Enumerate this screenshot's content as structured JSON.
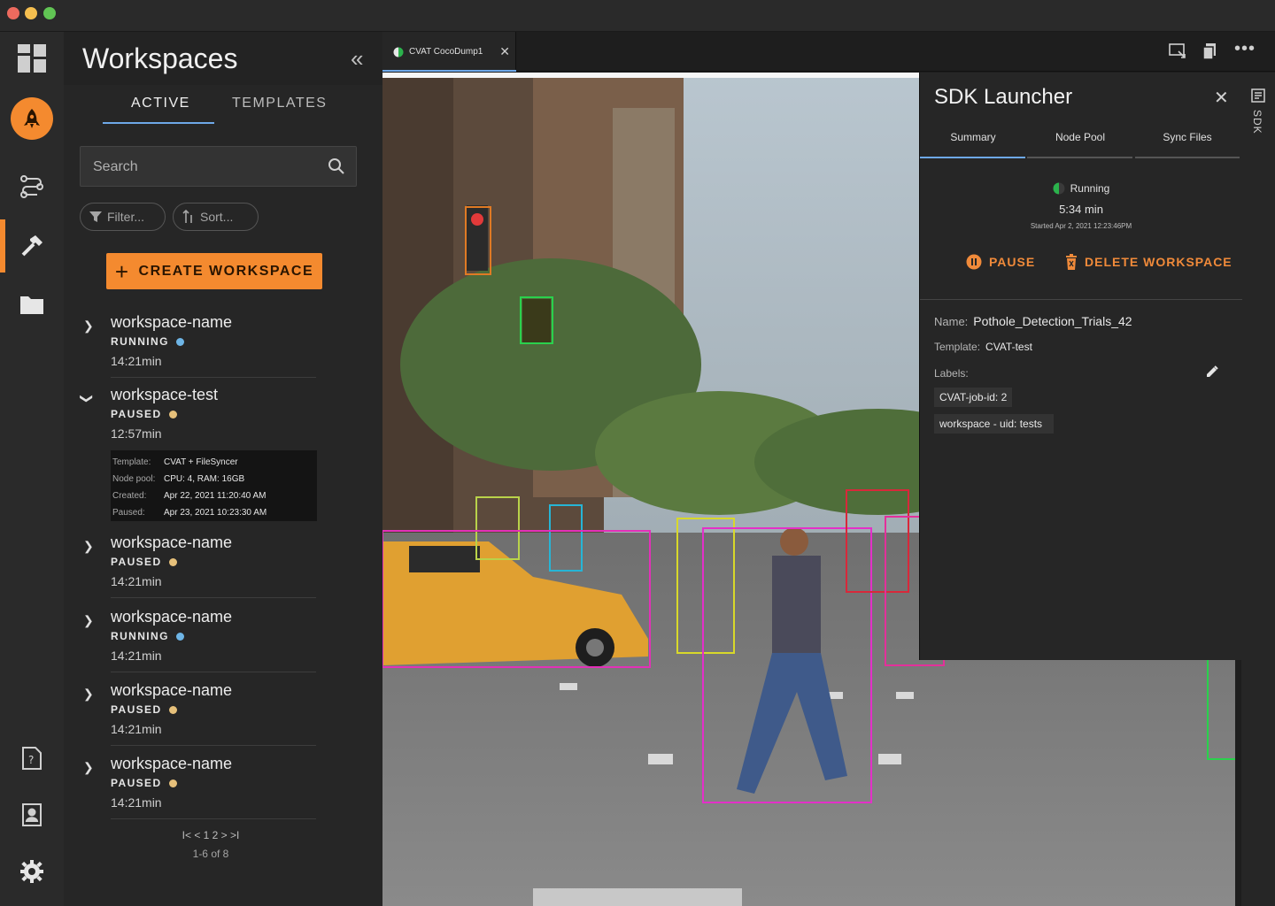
{
  "sidebar": {
    "title": "Workspaces",
    "tabs": [
      "ACTIVE",
      "TEMPLATES"
    ],
    "search_placeholder": "Search",
    "filter_label": "Filter...",
    "sort_label": "Sort...",
    "create_button": "CREATE WORKSPACE",
    "workspaces": [
      {
        "name": "workspace-name",
        "status": "RUNNING",
        "time": "14:21min"
      },
      {
        "name": "workspace-test",
        "status": "PAUSED",
        "time": "12:57min"
      },
      {
        "name": "workspace-name",
        "status": "PAUSED",
        "time": "14:21min"
      },
      {
        "name": "workspace-name",
        "status": "RUNNING",
        "time": "14:21min"
      },
      {
        "name": "workspace-name",
        "status": "PAUSED",
        "time": "14:21min"
      },
      {
        "name": "workspace-name",
        "status": "PAUSED",
        "time": "14:21min"
      }
    ],
    "details": {
      "template_label": "Template:",
      "template": "CVAT + FileSyncer",
      "nodepool_label": "Node pool:",
      "nodepool": "CPU: 4, RAM: 16GB",
      "created_label": "Created:",
      "created": "Apr 22, 2021 11:20:40 AM",
      "paused_label": "Paused:",
      "paused": "Apr 23, 2021 10:23:30 AM"
    },
    "pagination": {
      "controls": "I< < 1 2 > >I",
      "page1": "1",
      "page2": "2",
      "count": "1-6 of 8"
    }
  },
  "tab": {
    "label": "CVAT CocoDump1"
  },
  "sdk": {
    "vertical_label": "SDK",
    "title": "SDK Launcher",
    "tabs": [
      "Summary",
      "Node Pool",
      "Sync Files"
    ],
    "status": "Running",
    "duration": "5:34 min",
    "started": "Started Apr 2, 2021 12:23:46PM",
    "pause": "PAUSE",
    "delete": "DELETE WORKSPACE",
    "name_label": "Name:",
    "name": "Pothole_Detection_Trials_42",
    "template_label": "Template:",
    "template": "CVAT-test",
    "labels_label": "Labels:",
    "labels": [
      "CVAT-job-id: 2",
      "workspace - uid: tests"
    ]
  },
  "colors": {
    "accent": "#f48a2f",
    "running": "#6eb5e6",
    "paused": "#e6c07a",
    "tab_active": "#6ea8e8",
    "delete": "#f08a3a"
  }
}
